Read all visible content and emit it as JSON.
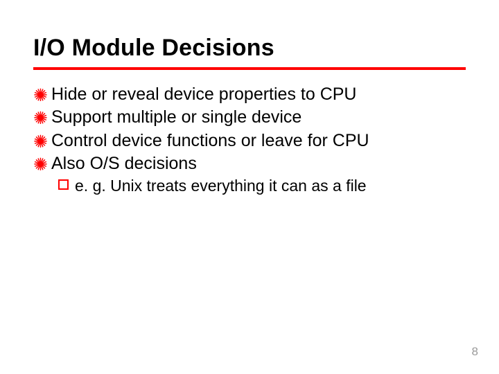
{
  "title": "I/O Module Decisions",
  "bullets": [
    {
      "text": "Hide or reveal device properties to CPU"
    },
    {
      "text": "Support multiple or single device"
    },
    {
      "text": "Control device functions or leave for CPU"
    },
    {
      "text": "Also O/S decisions"
    }
  ],
  "sub_bullets": [
    {
      "text": "e. g. Unix treats everything it can as a file"
    }
  ],
  "page_number": "8",
  "colors": {
    "accent": "#ff0000"
  }
}
